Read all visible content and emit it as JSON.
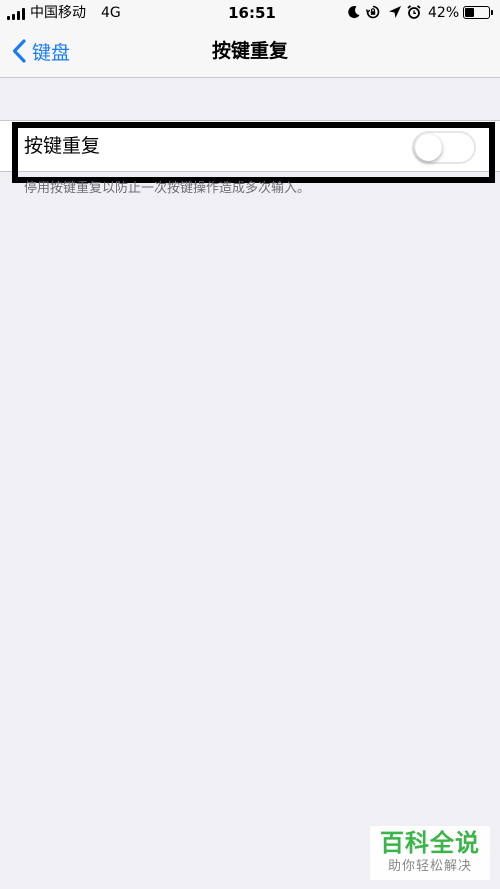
{
  "status_bar": {
    "carrier": "中国移动",
    "network": "4G",
    "time": "16:51",
    "battery_percent": "42%",
    "battery_level": 0.42,
    "icons": [
      "moon-icon",
      "orientation-lock-icon",
      "location-arrow-icon",
      "alarm-icon"
    ]
  },
  "nav": {
    "back_label": "键盘",
    "title": "按键重复"
  },
  "setting": {
    "label": "按键重复",
    "enabled": false,
    "footer": "停用按键重复以防止一次按键操作造成多次输入。"
  },
  "watermark": {
    "title": "百科全说",
    "subtitle": "助你轻松解决"
  },
  "colors": {
    "accent": "#1a7cf5",
    "background": "#efeff4",
    "watermark_green": "#3bb54a"
  }
}
